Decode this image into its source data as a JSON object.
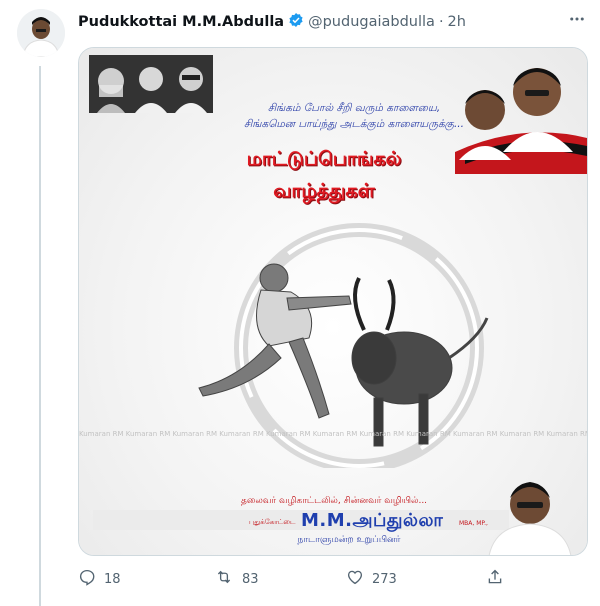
{
  "tweet": {
    "display_name": "Pudukkottai M.M.Abdulla",
    "handle": "@pudugaiabdulla",
    "separator": "·",
    "time": "2h",
    "more_icon": "more-icon",
    "verified_icon": "verified-badge-icon"
  },
  "poster": {
    "tagline_line1": "சிங்கம் போல் சீறி வரும் காளையை,",
    "tagline_line2": "சிங்கமென பாய்ந்து அடக்கும் காளையருக்கு...",
    "title_line1": "மாட்டுப்பொங்கல்",
    "title_line2": "வாழ்த்துகள்",
    "watermark": "Kumaran RM Kumaran RM Kumaran RM Kumaran RM Kumaran RM Kumaran RM Kumaran RM Kumaran RM Kumaran RM Kumaran RM Kumaran RM Kumara",
    "slogan": "தலைவர் வழிகாட்டலில், சின்னவர் வழியில்...",
    "name_prefix": "புதுக்கோட்டை",
    "name": "M.M.அப்துல்லா",
    "name_suffix": "MBA, MP.,",
    "designation": "நாடாளுமன்ற உறுப்பினர்"
  },
  "actions": {
    "reply_count": "18",
    "retweet_count": "83",
    "like_count": "273"
  },
  "colors": {
    "accent_blue": "#1d9bf0",
    "red": "#e21b23",
    "poster_blue": "#1f3fae"
  }
}
